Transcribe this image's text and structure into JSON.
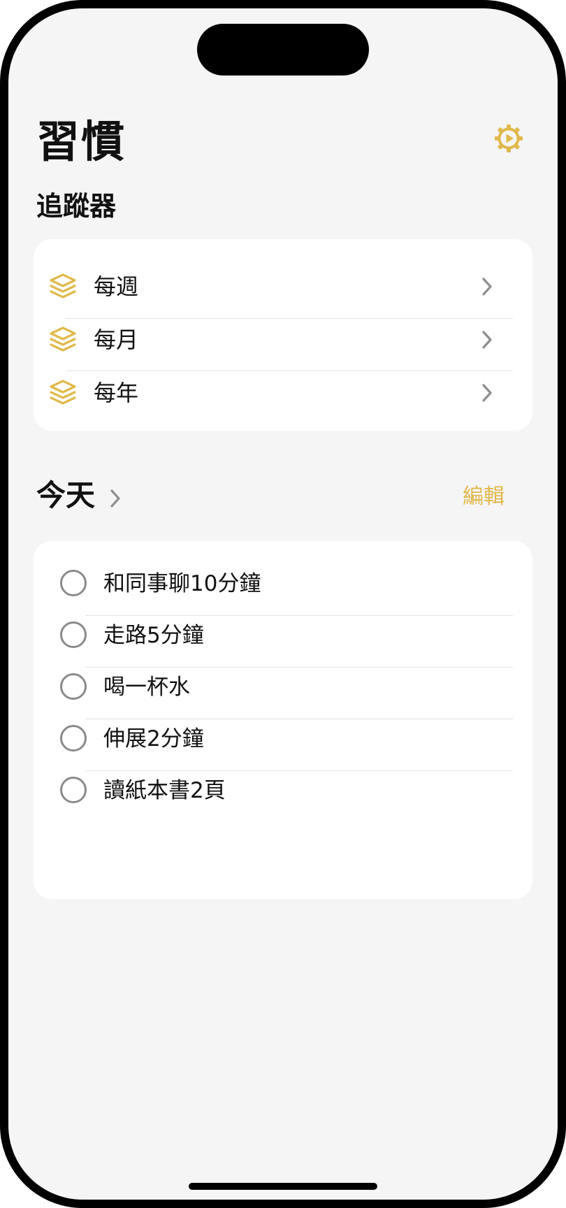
{
  "header": {
    "title": "習慣",
    "settings_icon": "gear-play-icon"
  },
  "colors": {
    "accent": "#e0b94c",
    "background": "#f5f5f5",
    "card": "#ffffff",
    "checkbox": "#8a8a8a",
    "chevron": "#8e8e8e"
  },
  "trackers": {
    "title": "追蹤器",
    "icon": "stack-icon",
    "items": [
      {
        "label": "每週"
      },
      {
        "label": "每月"
      },
      {
        "label": "每年"
      }
    ]
  },
  "today": {
    "title": "今天",
    "edit_label": "編輯",
    "habits": [
      {
        "label": "和同事聊10分鐘",
        "checked": false
      },
      {
        "label": "走路5分鐘",
        "checked": false
      },
      {
        "label": "喝一杯水",
        "checked": false
      },
      {
        "label": "伸展2分鐘",
        "checked": false
      },
      {
        "label": "讀紙本書2頁",
        "checked": false
      }
    ]
  }
}
